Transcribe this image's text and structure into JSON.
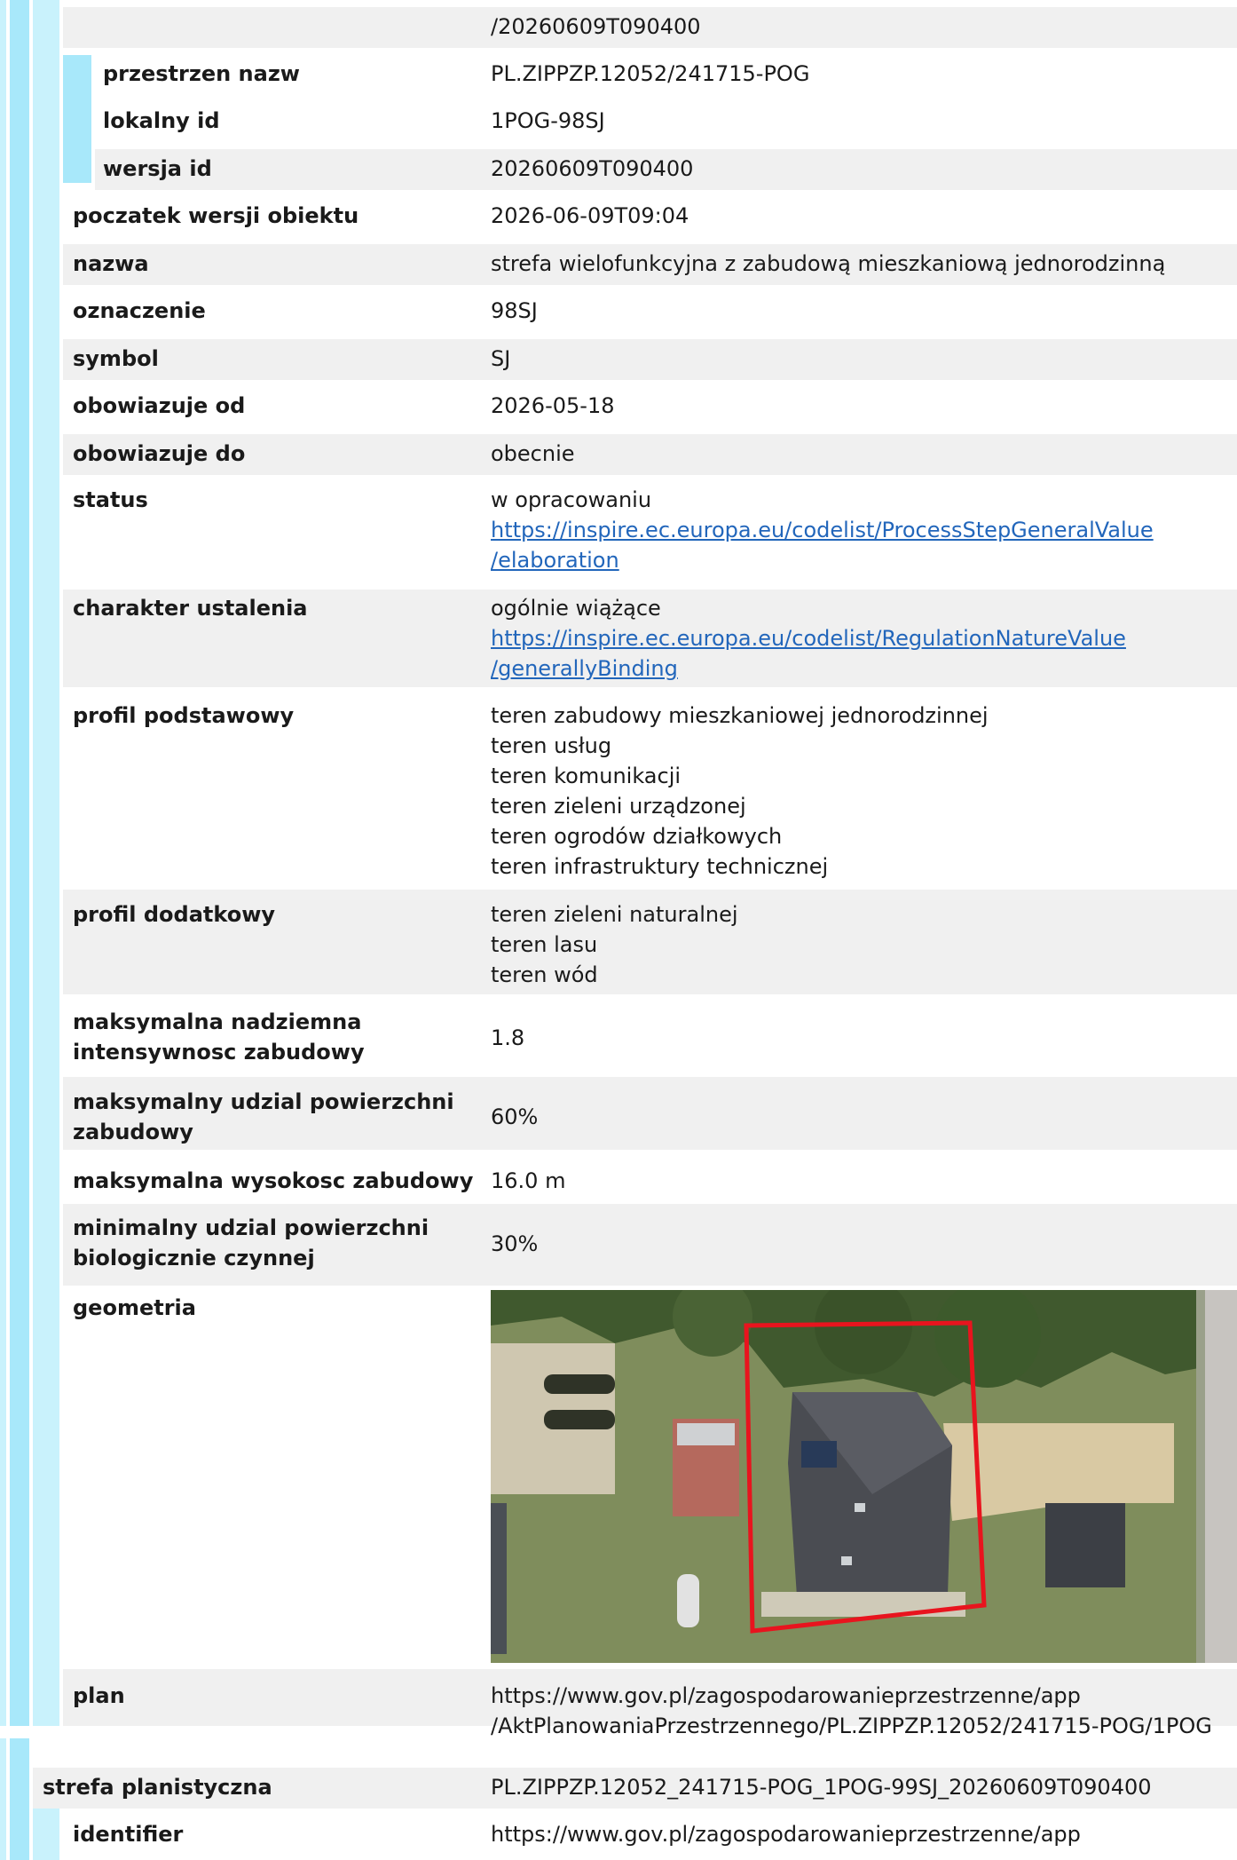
{
  "top_value": "/20260609T090400",
  "sub_rows": [
    {
      "label": "przestrzen nazw",
      "value": "PL.ZIPPZP.12052/241715-POG"
    },
    {
      "label": "lokalny id",
      "value": "1POG-98SJ"
    },
    {
      "label": "wersja id",
      "value": "20260609T090400"
    }
  ],
  "rows": [
    {
      "label": "poczatek wersji obiektu",
      "value": "2026-06-09T09:04"
    },
    {
      "label": "nazwa",
      "value": "strefa wielofunkcyjna z zabudową mieszkaniową jednorodzinną"
    },
    {
      "label": "oznaczenie",
      "value": "98SJ"
    },
    {
      "label": "symbol",
      "value": "SJ"
    },
    {
      "label": "obowiazuje od",
      "value": "2026-05-18"
    },
    {
      "label": "obowiazuje do",
      "value": "obecnie"
    }
  ],
  "status": {
    "label": "status",
    "value": "w opracowaniu",
    "link_line1": "https://inspire.ec.europa.eu/codelist/ProcessStepGeneralValue",
    "link_line2": "/elaboration"
  },
  "charakter": {
    "label": "charakter ustalenia",
    "value": "ogólnie wiążące",
    "link_line1": "https://inspire.ec.europa.eu/codelist/RegulationNatureValue",
    "link_line2": "/generallyBinding"
  },
  "profil_podstawowy": {
    "label": "profil podstawowy",
    "items": [
      "teren zabudowy mieszkaniowej jednorodzinnej",
      "teren usług",
      "teren komunikacji",
      "teren zieleni urządzonej",
      "teren ogrodów działkowych",
      "teren infrastruktury technicznej"
    ]
  },
  "profil_dodatkowy": {
    "label": "profil dodatkowy",
    "items": [
      "teren zieleni naturalnej",
      "teren lasu",
      "teren wód"
    ]
  },
  "max_intensywnosc": {
    "label_line1": "maksymalna nadziemna",
    "label_line2": "intensywnosc zabudowy",
    "value": "1.8"
  },
  "max_udzial": {
    "label_line1": "maksymalny udzial powierzchni",
    "label_line2": "zabudowy",
    "value": "60%"
  },
  "max_wysokosc": {
    "label": "maksymalna wysokosc zabudowy",
    "value": "16.0 m"
  },
  "min_bio": {
    "label_line1": "minimalny udzial powierzchni",
    "label_line2": "biologicznie czynnej",
    "value": "30%"
  },
  "geometria": {
    "label": "geometria",
    "outline_color": "#e8141e"
  },
  "plan": {
    "label": "plan",
    "line1": "https://www.gov.pl/zagospodarowanieprzestrzenne/app",
    "line2": "/AktPlanowaniaPrzestrzennego/PL.ZIPPZP.12052/241715-POG/1POG"
  },
  "next": {
    "label": "strefa planistyczna",
    "value": "PL.ZIPPZP.12052_241715-POG_1POG-99SJ_20260609T090400",
    "identifier_label": "identifier",
    "identifier_value": "https://www.gov.pl/zagospodarowanieprzestrzenne/app"
  }
}
